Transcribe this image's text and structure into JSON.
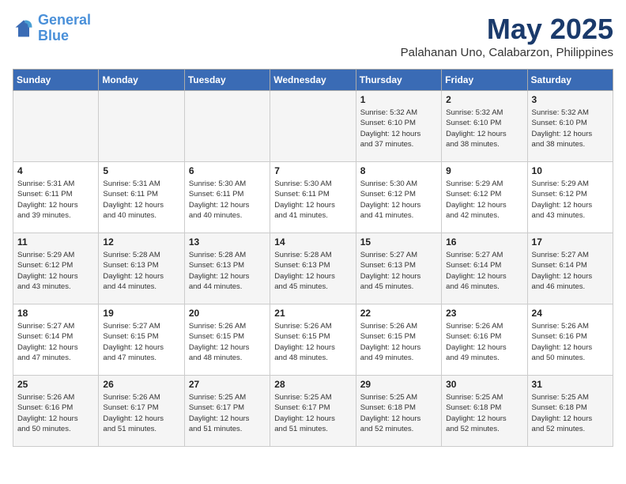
{
  "header": {
    "logo_line1": "General",
    "logo_line2": "Blue",
    "month": "May 2025",
    "location": "Palahanan Uno, Calabarzon, Philippines"
  },
  "weekdays": [
    "Sunday",
    "Monday",
    "Tuesday",
    "Wednesday",
    "Thursday",
    "Friday",
    "Saturday"
  ],
  "weeks": [
    [
      {
        "day": "",
        "info": ""
      },
      {
        "day": "",
        "info": ""
      },
      {
        "day": "",
        "info": ""
      },
      {
        "day": "",
        "info": ""
      },
      {
        "day": "1",
        "info": "Sunrise: 5:32 AM\nSunset: 6:10 PM\nDaylight: 12 hours\nand 37 minutes."
      },
      {
        "day": "2",
        "info": "Sunrise: 5:32 AM\nSunset: 6:10 PM\nDaylight: 12 hours\nand 38 minutes."
      },
      {
        "day": "3",
        "info": "Sunrise: 5:32 AM\nSunset: 6:10 PM\nDaylight: 12 hours\nand 38 minutes."
      }
    ],
    [
      {
        "day": "4",
        "info": "Sunrise: 5:31 AM\nSunset: 6:11 PM\nDaylight: 12 hours\nand 39 minutes."
      },
      {
        "day": "5",
        "info": "Sunrise: 5:31 AM\nSunset: 6:11 PM\nDaylight: 12 hours\nand 40 minutes."
      },
      {
        "day": "6",
        "info": "Sunrise: 5:30 AM\nSunset: 6:11 PM\nDaylight: 12 hours\nand 40 minutes."
      },
      {
        "day": "7",
        "info": "Sunrise: 5:30 AM\nSunset: 6:11 PM\nDaylight: 12 hours\nand 41 minutes."
      },
      {
        "day": "8",
        "info": "Sunrise: 5:30 AM\nSunset: 6:12 PM\nDaylight: 12 hours\nand 41 minutes."
      },
      {
        "day": "9",
        "info": "Sunrise: 5:29 AM\nSunset: 6:12 PM\nDaylight: 12 hours\nand 42 minutes."
      },
      {
        "day": "10",
        "info": "Sunrise: 5:29 AM\nSunset: 6:12 PM\nDaylight: 12 hours\nand 43 minutes."
      }
    ],
    [
      {
        "day": "11",
        "info": "Sunrise: 5:29 AM\nSunset: 6:12 PM\nDaylight: 12 hours\nand 43 minutes."
      },
      {
        "day": "12",
        "info": "Sunrise: 5:28 AM\nSunset: 6:13 PM\nDaylight: 12 hours\nand 44 minutes."
      },
      {
        "day": "13",
        "info": "Sunrise: 5:28 AM\nSunset: 6:13 PM\nDaylight: 12 hours\nand 44 minutes."
      },
      {
        "day": "14",
        "info": "Sunrise: 5:28 AM\nSunset: 6:13 PM\nDaylight: 12 hours\nand 45 minutes."
      },
      {
        "day": "15",
        "info": "Sunrise: 5:27 AM\nSunset: 6:13 PM\nDaylight: 12 hours\nand 45 minutes."
      },
      {
        "day": "16",
        "info": "Sunrise: 5:27 AM\nSunset: 6:14 PM\nDaylight: 12 hours\nand 46 minutes."
      },
      {
        "day": "17",
        "info": "Sunrise: 5:27 AM\nSunset: 6:14 PM\nDaylight: 12 hours\nand 46 minutes."
      }
    ],
    [
      {
        "day": "18",
        "info": "Sunrise: 5:27 AM\nSunset: 6:14 PM\nDaylight: 12 hours\nand 47 minutes."
      },
      {
        "day": "19",
        "info": "Sunrise: 5:27 AM\nSunset: 6:15 PM\nDaylight: 12 hours\nand 47 minutes."
      },
      {
        "day": "20",
        "info": "Sunrise: 5:26 AM\nSunset: 6:15 PM\nDaylight: 12 hours\nand 48 minutes."
      },
      {
        "day": "21",
        "info": "Sunrise: 5:26 AM\nSunset: 6:15 PM\nDaylight: 12 hours\nand 48 minutes."
      },
      {
        "day": "22",
        "info": "Sunrise: 5:26 AM\nSunset: 6:15 PM\nDaylight: 12 hours\nand 49 minutes."
      },
      {
        "day": "23",
        "info": "Sunrise: 5:26 AM\nSunset: 6:16 PM\nDaylight: 12 hours\nand 49 minutes."
      },
      {
        "day": "24",
        "info": "Sunrise: 5:26 AM\nSunset: 6:16 PM\nDaylight: 12 hours\nand 50 minutes."
      }
    ],
    [
      {
        "day": "25",
        "info": "Sunrise: 5:26 AM\nSunset: 6:16 PM\nDaylight: 12 hours\nand 50 minutes."
      },
      {
        "day": "26",
        "info": "Sunrise: 5:26 AM\nSunset: 6:17 PM\nDaylight: 12 hours\nand 51 minutes."
      },
      {
        "day": "27",
        "info": "Sunrise: 5:25 AM\nSunset: 6:17 PM\nDaylight: 12 hours\nand 51 minutes."
      },
      {
        "day": "28",
        "info": "Sunrise: 5:25 AM\nSunset: 6:17 PM\nDaylight: 12 hours\nand 51 minutes."
      },
      {
        "day": "29",
        "info": "Sunrise: 5:25 AM\nSunset: 6:18 PM\nDaylight: 12 hours\nand 52 minutes."
      },
      {
        "day": "30",
        "info": "Sunrise: 5:25 AM\nSunset: 6:18 PM\nDaylight: 12 hours\nand 52 minutes."
      },
      {
        "day": "31",
        "info": "Sunrise: 5:25 AM\nSunset: 6:18 PM\nDaylight: 12 hours\nand 52 minutes."
      }
    ]
  ]
}
